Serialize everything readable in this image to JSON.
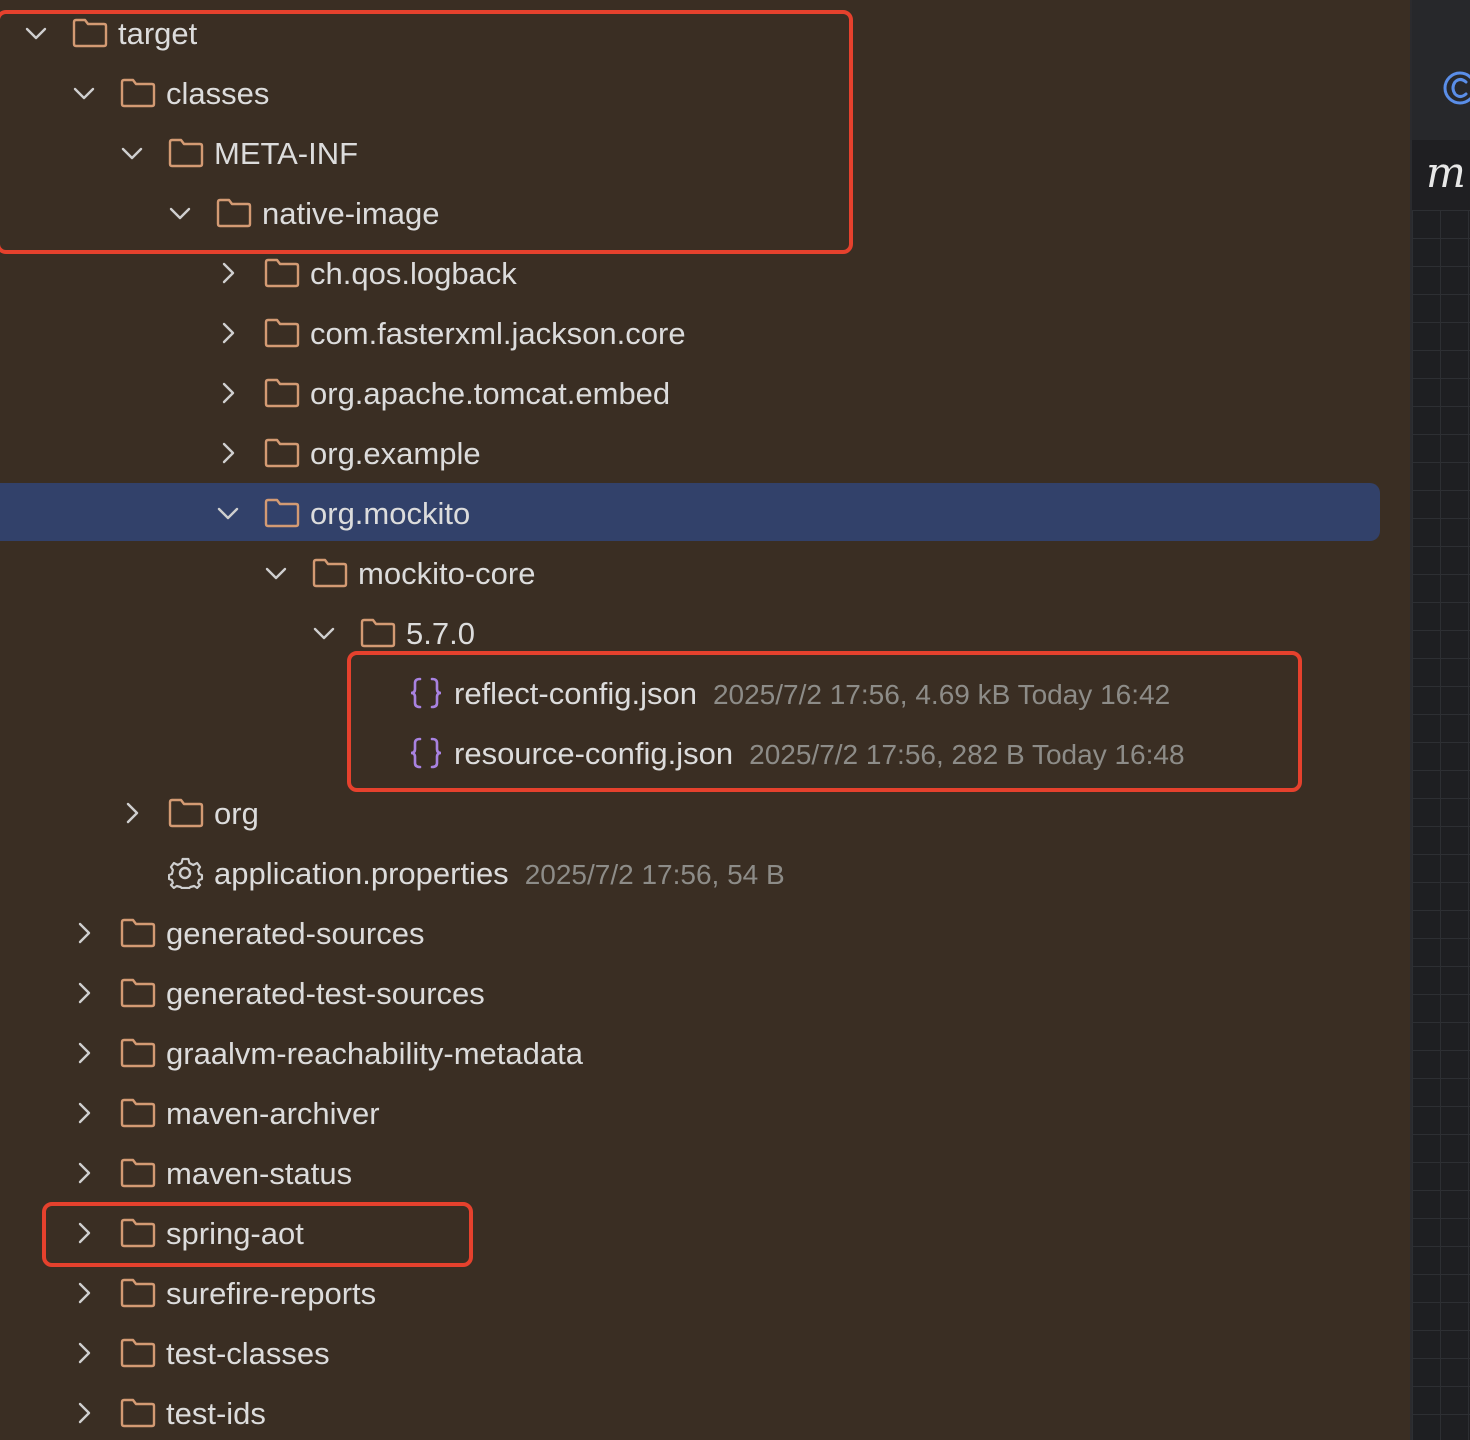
{
  "tree": {
    "rows": [
      {
        "label": "target",
        "meta": ""
      },
      {
        "label": "classes",
        "meta": ""
      },
      {
        "label": "META-INF",
        "meta": ""
      },
      {
        "label": "native-image",
        "meta": ""
      },
      {
        "label": "ch.qos.logback",
        "meta": ""
      },
      {
        "label": "com.fasterxml.jackson.core",
        "meta": ""
      },
      {
        "label": "org.apache.tomcat.embed",
        "meta": ""
      },
      {
        "label": "org.example",
        "meta": ""
      },
      {
        "label": "org.mockito",
        "meta": ""
      },
      {
        "label": "mockito-core",
        "meta": ""
      },
      {
        "label": "5.7.0",
        "meta": ""
      },
      {
        "label": "reflect-config.json",
        "meta": "2025/7/2 17:56, 4.69 kB Today 16:42"
      },
      {
        "label": "resource-config.json",
        "meta": "2025/7/2 17:56, 282 B Today 16:48"
      },
      {
        "label": "org",
        "meta": ""
      },
      {
        "label": "application.properties",
        "meta": "2025/7/2 17:56, 54 B"
      },
      {
        "label": "generated-sources",
        "meta": ""
      },
      {
        "label": "generated-test-sources",
        "meta": ""
      },
      {
        "label": "graalvm-reachability-metadata",
        "meta": ""
      },
      {
        "label": "maven-archiver",
        "meta": ""
      },
      {
        "label": "maven-status",
        "meta": ""
      },
      {
        "label": "spring-aot",
        "meta": ""
      },
      {
        "label": "surefire-reports",
        "meta": ""
      },
      {
        "label": "test-classes",
        "meta": ""
      },
      {
        "label": "test-ids",
        "meta": ""
      }
    ]
  },
  "right_panel": {
    "italic_letter": "m"
  },
  "colors": {
    "background": "#3a2e23",
    "selection": "#32416a",
    "folder_icon": "#d39a73",
    "json_icon": "#a882e0",
    "highlight_border": "#e5412d",
    "text": "#dcdcdc",
    "meta_text": "#8d8c88"
  }
}
